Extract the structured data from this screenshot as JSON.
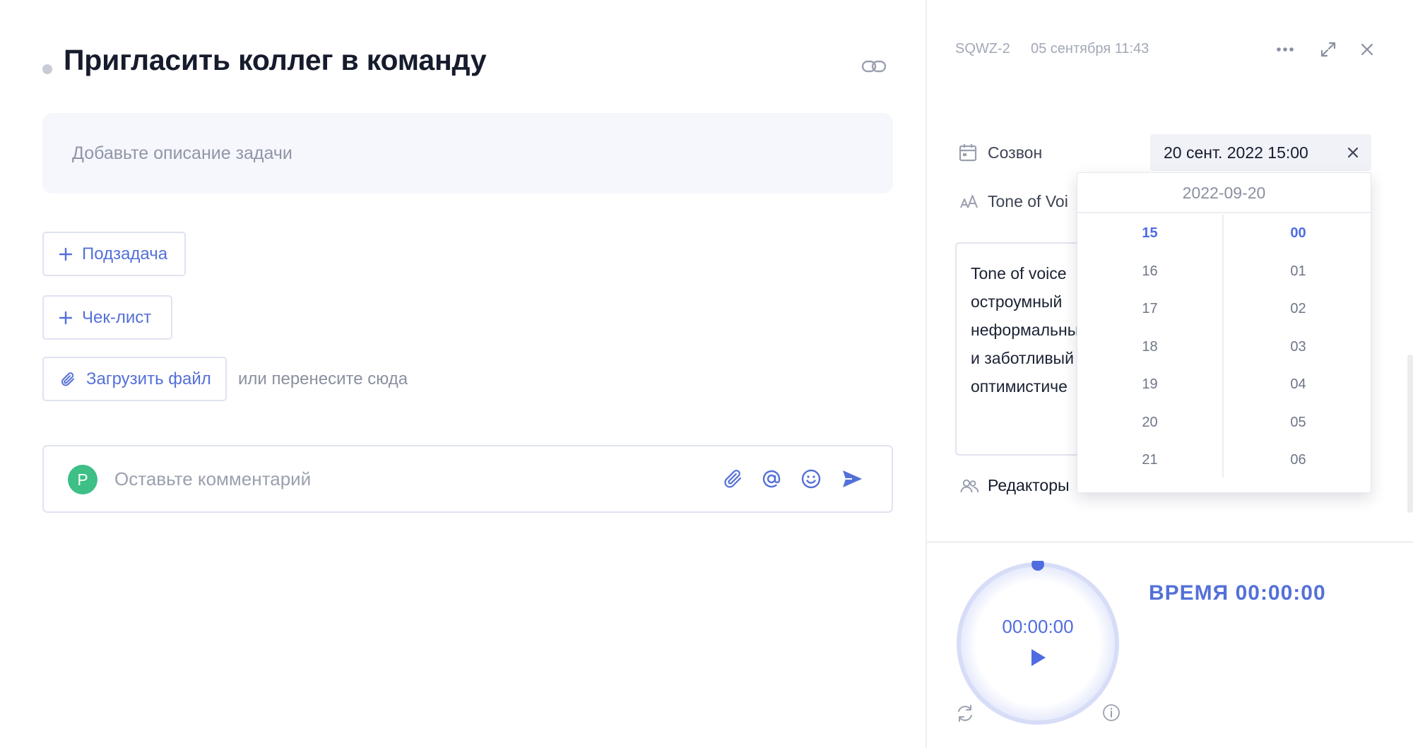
{
  "task": {
    "title": "Пригласить коллег в команду",
    "description_placeholder": "Добавьте описание задачи",
    "subtask_label": "Подзадача",
    "checklist_label": "Чек-лист",
    "upload_label": "Загрузить файл",
    "drop_hint": "или перенесите сюда"
  },
  "comment": {
    "avatar_letter": "P",
    "placeholder": "Оставьте комментарий"
  },
  "side": {
    "task_id": "SQWZ-2",
    "created": "05 сентября 11:43",
    "call": {
      "label": "Созвон",
      "value": "20 сент. 2022 15:00"
    },
    "tone": {
      "label": "Tone of Voi"
    },
    "tone_text": "Tone of voice\nостроумный\nнеформальны\nи заботливый\nоптимистиче",
    "editors": {
      "label": "Редакторы"
    },
    "picker": {
      "date": "2022-09-20",
      "hours": [
        "15",
        "16",
        "17",
        "18",
        "19",
        "20",
        "21"
      ],
      "minutes": [
        "00",
        "01",
        "02",
        "03",
        "04",
        "05",
        "06"
      ],
      "selected_hour": "15",
      "selected_minute": "00"
    },
    "timer": {
      "display": "00:00:00",
      "total_label": "ВРЕМЯ 00:00:00"
    }
  },
  "colors": {
    "accent": "#4f6ce0",
    "avatar": "#3dbf86",
    "placeholder_bg": "#f5f7fc"
  },
  "icons": [
    "link-icon",
    "plus-icon",
    "paperclip-icon",
    "at-icon",
    "emoji-icon",
    "send-icon",
    "more-icon",
    "expand-icon",
    "close-icon",
    "calendar-icon",
    "text-size-icon",
    "users-icon",
    "play-icon",
    "reset-icon",
    "info-icon"
  ]
}
